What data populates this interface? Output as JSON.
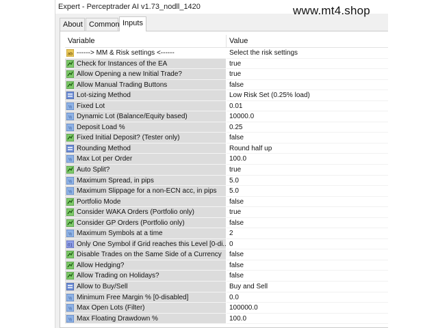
{
  "window": {
    "title": "Expert - Perceptrader AI v1.73_nodll_1420"
  },
  "watermark": "www.mt4.shop",
  "tabs": [
    "About",
    "Common",
    "Inputs"
  ],
  "table": {
    "col_variable": "Variable",
    "col_value": "Value",
    "rows": [
      {
        "icon": "string-icon",
        "name": "------> MM & Risk settings <------",
        "value": "Select the risk settings"
      },
      {
        "icon": "bool-icon",
        "name": "Check for Instances of the EA",
        "value": "true"
      },
      {
        "icon": "bool-icon",
        "name": "Allow Opening a new Initial Trade?",
        "value": "true"
      },
      {
        "icon": "bool-icon",
        "name": "Allow Manual Trading Buttons",
        "value": "false"
      },
      {
        "icon": "enum-icon",
        "name": "Lot-sizing Method",
        "value": "Low Risk Set (0.25% load)"
      },
      {
        "icon": "number-icon",
        "name": "Fixed Lot",
        "value": "0.01"
      },
      {
        "icon": "number-icon",
        "name": "Dynamic Lot (Balance/Equity based)",
        "value": "10000.0"
      },
      {
        "icon": "number-icon",
        "name": "Deposit Load %",
        "value": "0.25"
      },
      {
        "icon": "bool-icon",
        "name": "Fixed Initial Deposit? (Tester only)",
        "value": "false"
      },
      {
        "icon": "enum-icon",
        "name": "Rounding Method",
        "value": "Round half up"
      },
      {
        "icon": "number-icon",
        "name": "Max Lot per Order",
        "value": "100.0"
      },
      {
        "icon": "bool-icon",
        "name": "Auto Split?",
        "value": "true"
      },
      {
        "icon": "number-icon",
        "name": "Maximum Spread, in pips",
        "value": "5.0"
      },
      {
        "icon": "number-icon",
        "name": "Maximum Slippage for a non-ECN acc, in pips",
        "value": "5.0"
      },
      {
        "icon": "bool-icon",
        "name": "Portfolio Mode",
        "value": "false"
      },
      {
        "icon": "bool-icon",
        "name": "Consider WAKA Orders (Portfolio only)",
        "value": "true"
      },
      {
        "icon": "bool-icon",
        "name": "Consider GP Orders (Portfolio only)",
        "value": "false"
      },
      {
        "icon": "number-icon",
        "name": "Maximum Symbols at a time",
        "value": "2"
      },
      {
        "icon": "integer-icon",
        "name": "Only One Symbol if Grid reaches this Level [0-di...",
        "value": "0"
      },
      {
        "icon": "bool-icon",
        "name": "Disable Trades on the Same Side of a Currency",
        "value": "false"
      },
      {
        "icon": "bool-icon",
        "name": "Allow Hedging?",
        "value": "false"
      },
      {
        "icon": "bool-icon",
        "name": "Allow Trading on Holidays?",
        "value": "false"
      },
      {
        "icon": "enum-icon",
        "name": "Allow to Buy/Sell",
        "value": "Buy and Sell"
      },
      {
        "icon": "number-icon",
        "name": "Minimum Free Margin % [0-disabled]",
        "value": "0.0"
      },
      {
        "icon": "number-icon",
        "name": "Max Open Lots (Filter)",
        "value": "100000.0"
      },
      {
        "icon": "number-icon",
        "name": "Max Floating Drawdown %",
        "value": "100.0"
      }
    ]
  }
}
